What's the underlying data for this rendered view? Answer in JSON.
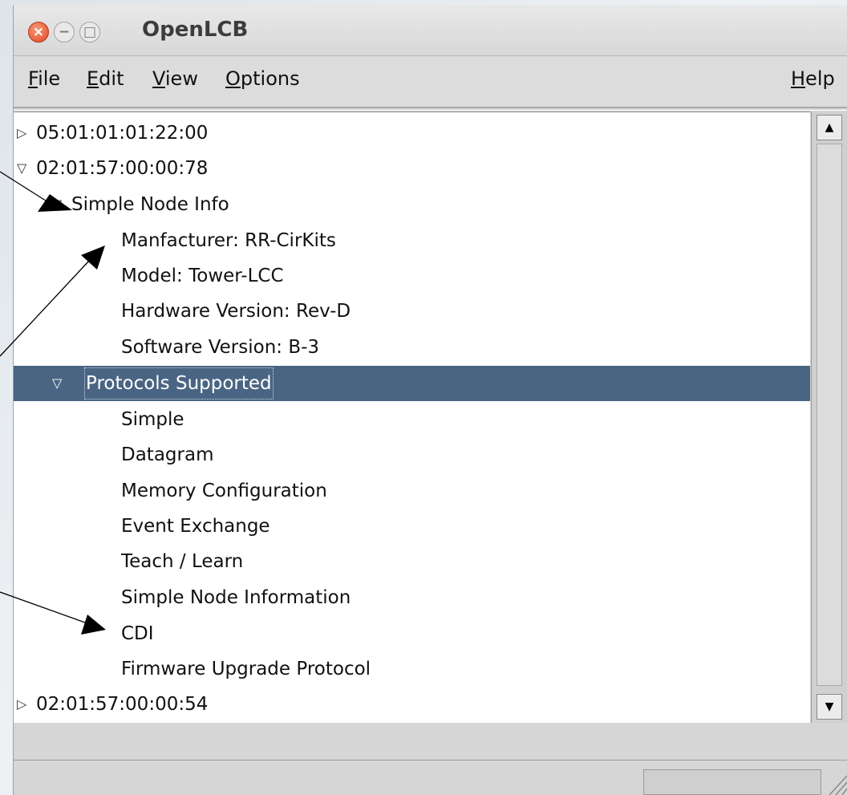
{
  "window": {
    "title": "OpenLCB",
    "close_glyph": "×",
    "minimize_glyph": "−",
    "maximize_glyph": "□"
  },
  "menu": {
    "file": {
      "mnemonic": "F",
      "rest": "ile"
    },
    "edit": {
      "mnemonic": "E",
      "rest": "dit"
    },
    "view": {
      "mnemonic": "V",
      "rest": "iew"
    },
    "options": {
      "mnemonic": "O",
      "rest": "ptions"
    },
    "help": {
      "mnemonic": "H",
      "rest": "elp"
    }
  },
  "tree": {
    "expanded_glyph": "▽",
    "collapsed_glyph": "▷",
    "rows": [
      {
        "label": "05:01:01:01:22:00",
        "level": 0,
        "state": "collapsed"
      },
      {
        "label": "02:01:57:00:00:78",
        "level": 0,
        "state": "expanded"
      },
      {
        "label": "Simple Node Info",
        "level": 1,
        "state": "expanded"
      },
      {
        "label": "Manfacturer: RR-CirKits",
        "level": 2,
        "state": "leaf"
      },
      {
        "label": "Model: Tower-LCC",
        "level": 2,
        "state": "leaf"
      },
      {
        "label": "Hardware Version: Rev-D",
        "level": 2,
        "state": "leaf"
      },
      {
        "label": "Software Version: B-3",
        "level": 2,
        "state": "leaf"
      },
      {
        "label": "Protocols Supported",
        "level": 1,
        "state": "expanded",
        "selected": true
      },
      {
        "label": "Simple",
        "level": 2,
        "state": "leaf"
      },
      {
        "label": "Datagram",
        "level": 2,
        "state": "leaf"
      },
      {
        "label": "Memory Configuration",
        "level": 2,
        "state": "leaf"
      },
      {
        "label": "Event Exchange",
        "level": 2,
        "state": "leaf"
      },
      {
        "label": "Teach / Learn",
        "level": 2,
        "state": "leaf"
      },
      {
        "label": "Simple Node Information",
        "level": 2,
        "state": "leaf"
      },
      {
        "label": "CDI",
        "level": 2,
        "state": "leaf"
      },
      {
        "label": "Firmware Upgrade Protocol",
        "level": 2,
        "state": "leaf"
      },
      {
        "label": "02:01:57:00:00:54",
        "level": 0,
        "state": "collapsed"
      }
    ]
  },
  "scrollbar": {
    "up_glyph": "▲",
    "down_glyph": "▼"
  },
  "colors": {
    "selection": "#4a6583",
    "close_button": "#e0461f"
  }
}
